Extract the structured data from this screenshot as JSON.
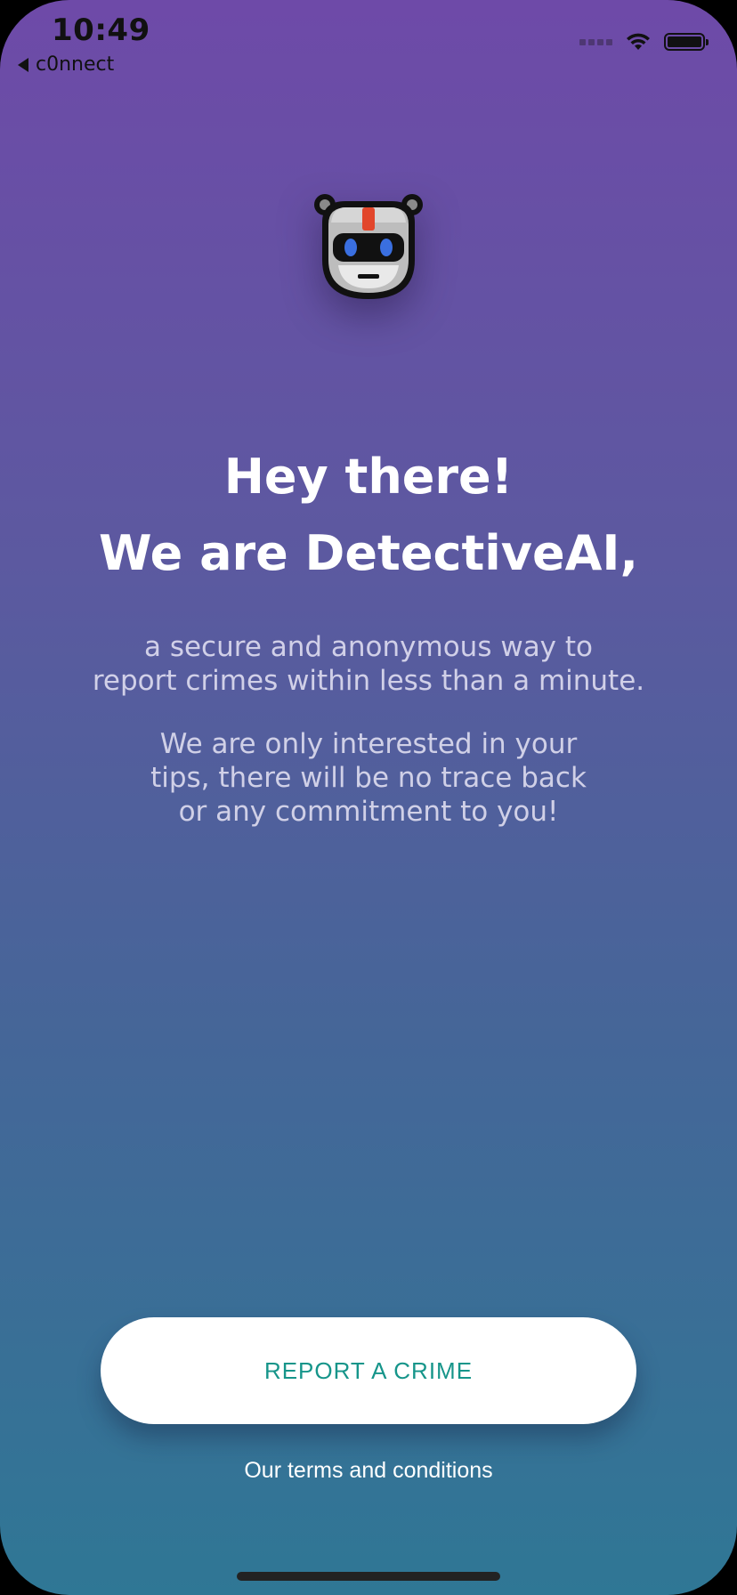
{
  "status_bar": {
    "time": "10:49",
    "back_label": "c0nnect",
    "icons": [
      "cellular-signal-icon",
      "wifi-icon",
      "battery-icon"
    ]
  },
  "hero": {
    "logo_icon": "robot-face-icon",
    "line1": "Hey there!",
    "line2": "We are DetectiveAI,"
  },
  "description": {
    "paragraph1": "a secure and anonymous way to\nreport crimes within less than a minute.",
    "paragraph2": "We are only interested in your\ntips, there will be no trace back\nor any commitment to you!"
  },
  "actions": {
    "report_button": "REPORT A CRIME",
    "terms_link": "Our terms and conditions"
  },
  "colors": {
    "gradient_top": "#6e4aa8",
    "gradient_bottom": "#2f7795",
    "button_text": "#16958a",
    "button_bg": "#ffffff"
  }
}
